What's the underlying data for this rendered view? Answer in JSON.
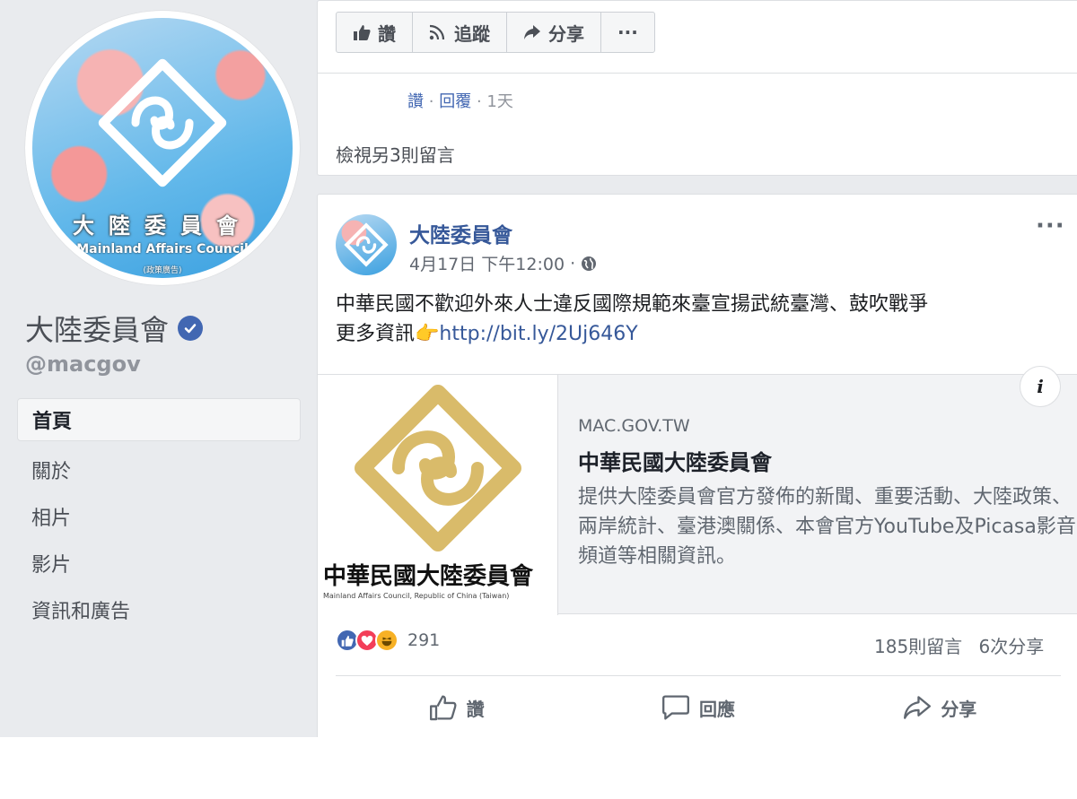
{
  "profile": {
    "avatar_title": "大陸委員會",
    "avatar_en": "Mainland Affairs Council",
    "avatar_small": "(政策廣告)",
    "name": "大陸委員會",
    "handle": "@macgov"
  },
  "nav": [
    {
      "label": "首頁",
      "active": true
    },
    {
      "label": "關於"
    },
    {
      "label": "相片"
    },
    {
      "label": "影片"
    },
    {
      "label": "資訊和廣告"
    }
  ],
  "toolbar": {
    "like_label": "讚",
    "follow_label": "追蹤",
    "share_label": "分享",
    "more_label": "···"
  },
  "comment": {
    "like": "讚",
    "reply": "回覆",
    "time": "1天",
    "separator": "·"
  },
  "view_more_comments": "檢視另3則留言",
  "post": {
    "author": "大陸委員會",
    "timestamp": "4月17日 下午12:00",
    "more": "···",
    "text_line1": "中華民國不歡迎外來人士違反國際規範來臺宣揚武統臺灣、鼓吹戰爭",
    "text_line2_prefix": "更多資訊",
    "pointing_emoji": "👉",
    "link": "http://bit.ly/2Uj646Y",
    "preview": {
      "image_title": "中華民國大陸委員會",
      "image_subtitle": "Mainland Affairs Council, Republic of China (Taiwan)",
      "info_label": "i",
      "domain": "MAC.GOV.TW",
      "title": "中華民國大陸委員會",
      "description": "提供大陸委員會官方發佈的新聞、重要活動、大陸政策、兩岸統計、臺港澳關係、本會官方YouTube及Picasa影音頻道等相關資訊。"
    },
    "reaction_count": "291",
    "comment_count": "185則留言",
    "share_count": "6次分享",
    "actions": {
      "like": "讚",
      "comment": "回應",
      "share": "分享"
    }
  },
  "colors": {
    "facebook_blue": "#4267b2",
    "link_blue": "#365899",
    "logo_gold": "#d9bb6a"
  }
}
